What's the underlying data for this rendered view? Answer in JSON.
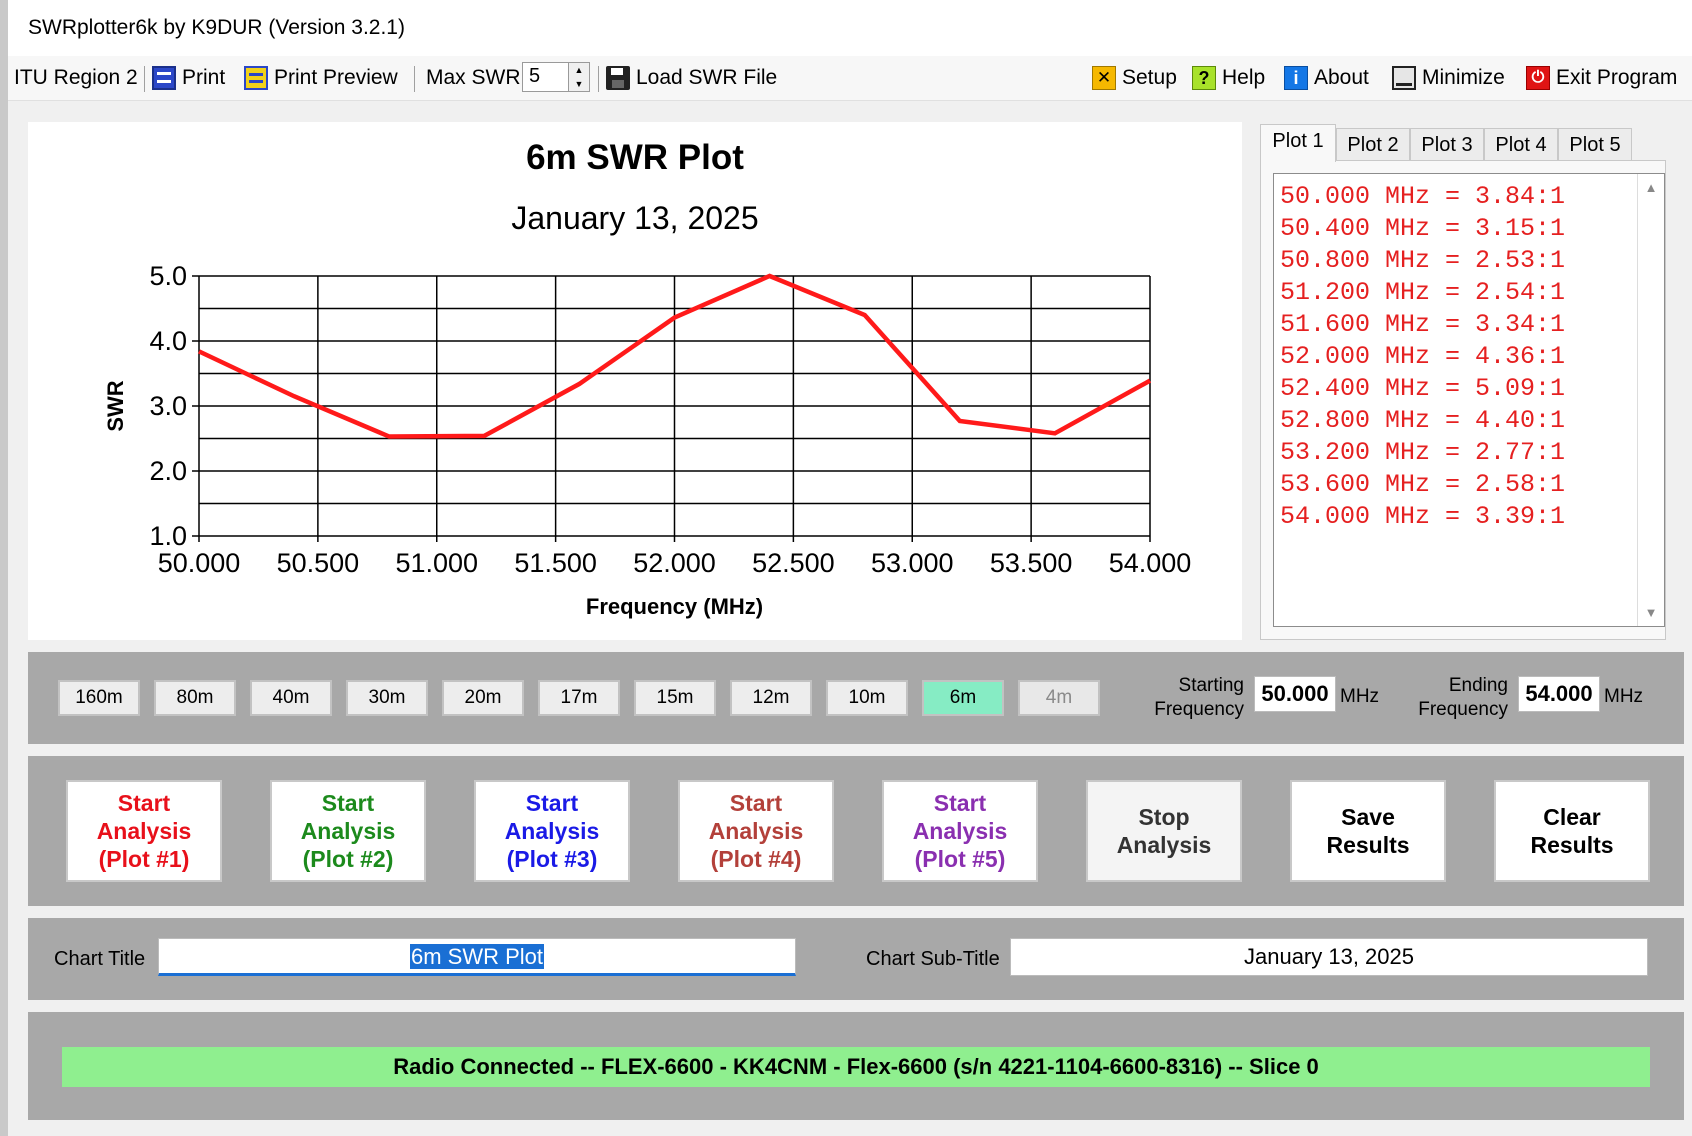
{
  "window": {
    "title": "SWRplotter6k by K9DUR (Version 3.2.1)"
  },
  "toolbar": {
    "region": "ITU Region 2",
    "print": "Print",
    "print_preview": "Print Preview",
    "max_swr_label": "Max SWR",
    "max_swr_value": "5",
    "load_file": "Load SWR File",
    "setup": "Setup",
    "help": "Help",
    "about": "About",
    "minimize": "Minimize",
    "exit": "Exit Program"
  },
  "icons": {
    "print": "printer-icon",
    "print_preview": "print-preview-icon",
    "load_file": "floppy-disk-icon",
    "setup": "tools-icon",
    "help": "question-mark-icon",
    "about": "info-icon",
    "minimize": "minimize-icon",
    "exit": "power-icon"
  },
  "colors": {
    "plot_line": "#ff1a1a",
    "list_text": "#e52020",
    "status_bg": "#8fef8f",
    "active_band": "#86ecc4",
    "plot1": "#e8101a",
    "plot2": "#1c8a1c",
    "plot3": "#1a1ae6",
    "plot4": "#b3403a",
    "plot5": "#8a2fb0"
  },
  "chart_data": {
    "type": "line",
    "title": "6m SWR Plot",
    "subtitle": "January 13, 2025",
    "xlabel": "Frequency (MHz)",
    "ylabel": "SWR",
    "x": [
      50.0,
      50.4,
      50.8,
      51.2,
      51.6,
      52.0,
      52.4,
      52.8,
      53.2,
      53.6,
      54.0
    ],
    "series": [
      {
        "values": [
          3.84,
          3.15,
          2.53,
          2.54,
          3.34,
          4.36,
          5.09,
          4.4,
          2.77,
          2.58,
          3.39
        ]
      }
    ],
    "xlim": [
      50.0,
      54.0
    ],
    "ylim": [
      1.0,
      5.0
    ],
    "xticks": [
      "50.000",
      "50.500",
      "51.000",
      "51.500",
      "52.000",
      "52.500",
      "53.000",
      "53.500",
      "54.000"
    ],
    "yticks": [
      "1.0",
      "2.0",
      "3.0",
      "4.0",
      "5.0"
    ],
    "grid": true,
    "legend": "none"
  },
  "plot_tabs": [
    "Plot 1",
    "Plot 2",
    "Plot 3",
    "Plot 4",
    "Plot 5"
  ],
  "results": [
    "50.000 MHz = 3.84:1",
    "50.400 MHz = 3.15:1",
    "50.800 MHz = 2.53:1",
    "51.200 MHz = 2.54:1",
    "51.600 MHz = 3.34:1",
    "52.000 MHz = 4.36:1",
    "52.400 MHz = 5.09:1",
    "52.800 MHz = 4.40:1",
    "53.200 MHz = 2.77:1",
    "53.600 MHz = 2.58:1",
    "54.000 MHz = 3.39:1"
  ],
  "bands": [
    "160m",
    "80m",
    "40m",
    "30m",
    "20m",
    "17m",
    "15m",
    "12m",
    "10m",
    "6m",
    "4m"
  ],
  "frequency": {
    "start_label_1": "Starting",
    "start_label_2": "Frequency",
    "start_value": "50.000",
    "start_unit": "MHz",
    "end_label_1": "Ending",
    "end_label_2": "Frequency",
    "end_value": "54.000",
    "end_unit": "MHz"
  },
  "actions": [
    {
      "label": "Start\nAnalysis\n(Plot #1)"
    },
    {
      "label": "Start\nAnalysis\n(Plot #2)"
    },
    {
      "label": "Start\nAnalysis\n(Plot #3)"
    },
    {
      "label": "Start\nAnalysis\n(Plot #4)"
    },
    {
      "label": "Start\nAnalysis\n(Plot #5)"
    },
    {
      "label": "Stop\nAnalysis"
    },
    {
      "label": "Save\nResults"
    },
    {
      "label": "Clear\nResults"
    }
  ],
  "titles": {
    "chart_title_label": "Chart Title",
    "chart_title_value": "6m SWR Plot",
    "chart_subtitle_label": "Chart Sub-Title",
    "chart_subtitle_value": "January 13, 2025"
  },
  "status": "Radio Connected -- FLEX-6600 - KK4CNM - Flex-6600  (s/n 4221-1104-6600-8316) -- Slice 0"
}
